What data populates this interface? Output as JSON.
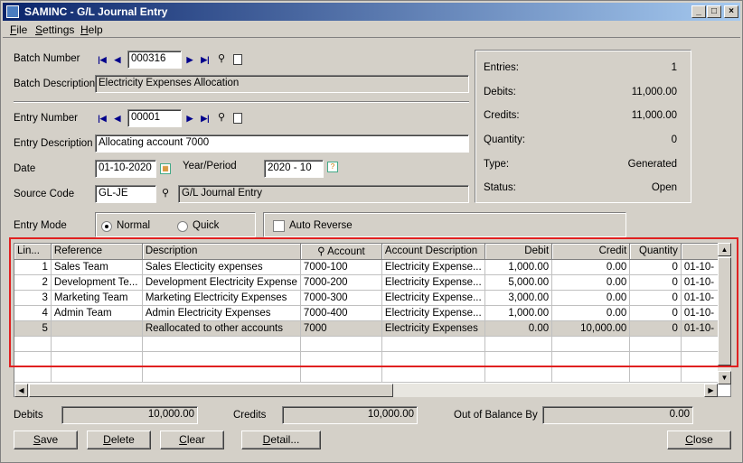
{
  "window": {
    "title": "SAMINC - G/L Journal Entry",
    "minimize": "_",
    "maximize": "□",
    "close": "×"
  },
  "menu": {
    "file": "File",
    "settings": "Settings",
    "help": "Help"
  },
  "batch": {
    "number_label": "Batch Number",
    "number": "000316",
    "description_label": "Batch Description",
    "description": "Electricity Expenses Allocation"
  },
  "entry": {
    "number_label": "Entry Number",
    "number": "00001",
    "description_label": "Entry Description",
    "description": "Allocating account 7000",
    "date_label": "Date",
    "date": "01-10-2020",
    "year_period_label": "Year/Period",
    "year_period": "2020 - 10",
    "source_code_label": "Source Code",
    "source_code": "GL-JE",
    "source_description": "G/L Journal Entry",
    "mode_label": "Entry Mode",
    "mode_normal": "Normal",
    "mode_quick": "Quick",
    "mode_selected": "Normal",
    "auto_reverse_label": "Auto Reverse",
    "auto_reverse_checked": false
  },
  "summary": {
    "entries_label": "Entries:",
    "entries": "1",
    "debits_label": "Debits:",
    "debits": "11,000.00",
    "credits_label": "Credits:",
    "credits": "11,000.00",
    "quantity_label": "Quantity:",
    "quantity": "0",
    "type_label": "Type:",
    "type": "Generated",
    "status_label": "Status:",
    "status": "Open"
  },
  "grid": {
    "columns": [
      "Lin...",
      "Reference",
      "Description",
      "Account",
      "Account Description",
      "Debit",
      "Credit",
      "Quantity",
      ""
    ],
    "rows": [
      [
        "1",
        "Sales Team",
        "Sales Electicity expenses",
        "7000-100",
        "Electricity Expense...",
        "1,000.00",
        "0.00",
        "0",
        "01-10-"
      ],
      [
        "2",
        "Development Te...",
        "Development Electricity Expense",
        "7000-200",
        "Electricity Expense...",
        "5,000.00",
        "0.00",
        "0",
        "01-10-"
      ],
      [
        "3",
        "Marketing Team",
        "Marketing Electricity Expenses",
        "7000-300",
        "Electricity Expense...",
        "3,000.00",
        "0.00",
        "0",
        "01-10-"
      ],
      [
        "4",
        "Admin Team",
        "Admin Electricity Expenses",
        "7000-400",
        "Electricity Expense...",
        "1,000.00",
        "0.00",
        "0",
        "01-10-"
      ],
      [
        "5",
        "",
        "Reallocated to other accounts",
        "7000",
        "Electricity Expenses",
        "0.00",
        "10,000.00",
        "0",
        "01-10-"
      ]
    ]
  },
  "totals": {
    "debits_label": "Debits",
    "debits": "10,000.00",
    "credits_label": "Credits",
    "credits": "10,000.00",
    "out_of_balance_label": "Out of Balance By",
    "out_of_balance": "0.00"
  },
  "buttons": {
    "save": "Save",
    "delete": "Delete",
    "clear": "Clear",
    "detail": "Detail...",
    "close": "Close"
  }
}
